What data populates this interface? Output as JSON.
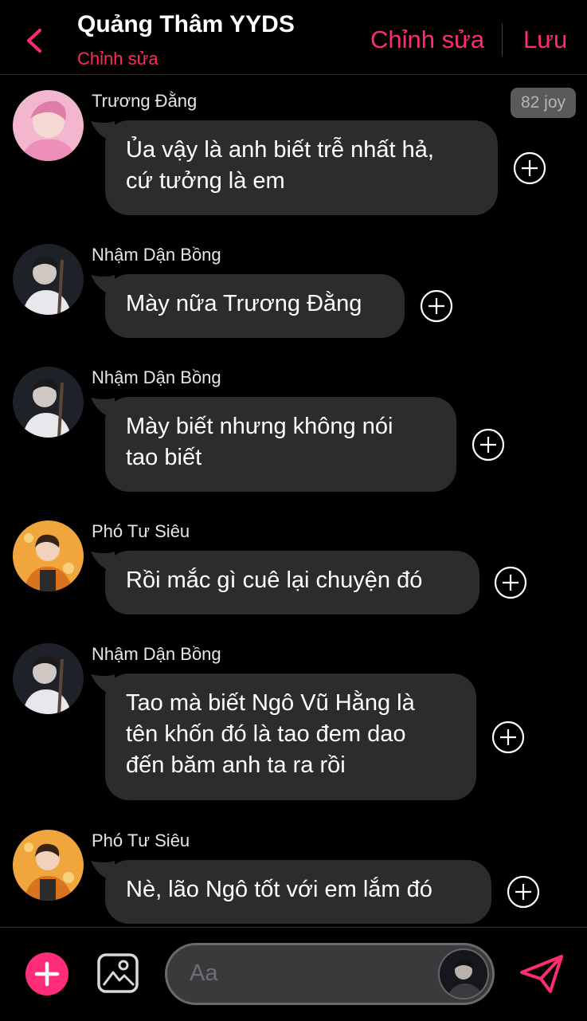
{
  "header": {
    "title": "Quảng Thâm YYDS",
    "subtitle": "Chỉnh sửa",
    "edit_label": "Chỉnh sửa",
    "save_label": "Lưu"
  },
  "badge": {
    "joy": "82 joy"
  },
  "messages": [
    {
      "sender": "Trương Đằng",
      "lines": [
        "Ủa vậy là anh biết trễ nhất hả,",
        "cứ tưởng là em"
      ],
      "avatar": "pink"
    },
    {
      "sender": "Nhậm Dận Bồng",
      "lines": [
        "Mày nữa Trương Đằng"
      ],
      "avatar": "dark"
    },
    {
      "sender": "Nhậm Dận Bồng",
      "lines": [
        "Mày biết nhưng không nói",
        "tao biết"
      ],
      "avatar": "dark"
    },
    {
      "sender": "Phó Tư Siêu",
      "lines": [
        "Rồi mắc gì cuê lại chuyện đó"
      ],
      "avatar": "orange"
    },
    {
      "sender": "Nhậm Dận Bồng",
      "lines": [
        "Tao mà biết Ngô Vũ Hằng là",
        "tên khốn đó là tao đem dao",
        "đến băm anh ta ra rồi"
      ],
      "avatar": "dark"
    },
    {
      "sender": "Phó Tư Siêu",
      "lines": [
        "Nè, lão Ngô tốt với em lắm đó"
      ],
      "avatar": "orange"
    }
  ],
  "composer": {
    "placeholder": "Aa"
  },
  "colors": {
    "accent": "#ff2d6f",
    "bubble": "#2c2c2e",
    "background": "#000000"
  },
  "icons": [
    "back-chevron-icon",
    "add-reaction-icon",
    "plus-icon",
    "gallery-icon",
    "send-icon"
  ]
}
